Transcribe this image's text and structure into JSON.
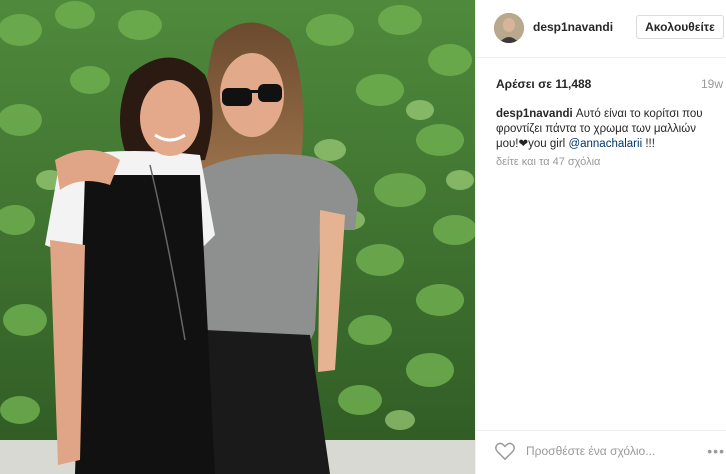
{
  "post": {
    "username": "desp1navandi",
    "follow_label": "Ακολουθείτε",
    "likes_text": "Αρέσει σε 11,488",
    "time": "19w",
    "caption_user": "desp1navandi",
    "caption_text_1": " Αυτό είναι το κορίτσι που φροντίζει πάντα το χρωμα των μαλλιών μου!",
    "caption_heart": "❤",
    "caption_text_2": "you girl ",
    "caption_mention": "@annachalarii",
    "caption_end": " !!!",
    "view_comments": "δείτε και τα 47 σχόλια",
    "comment_placeholder": "Προσθέστε ένα σχόλιο...",
    "more_label": "•••"
  },
  "colors": {
    "link": "#003569",
    "muted": "#999999",
    "border": "#efefef"
  },
  "icons": {
    "like": "heart-outline-icon"
  }
}
